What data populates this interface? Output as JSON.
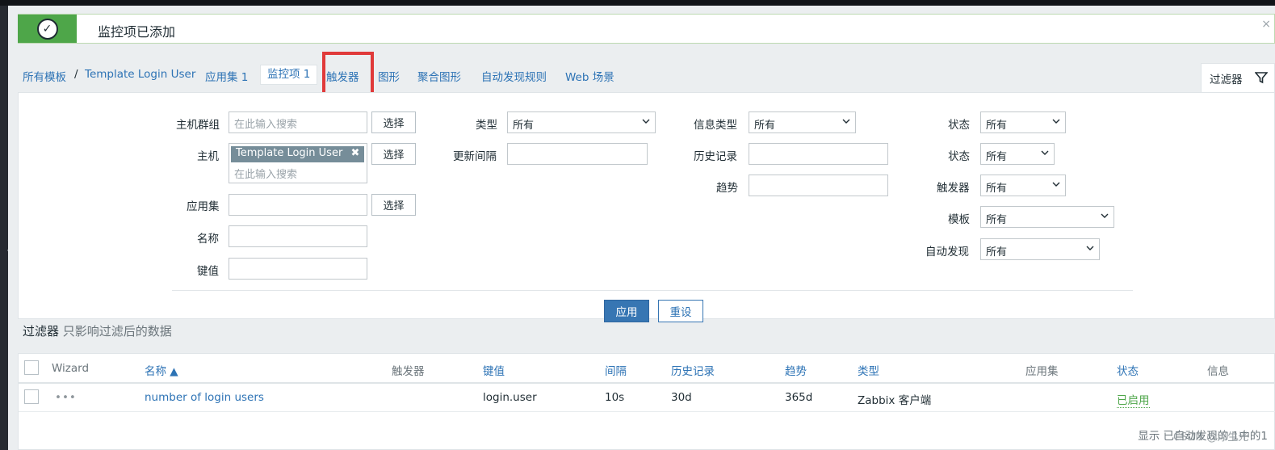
{
  "message": {
    "text": "监控项已添加",
    "close_glyph": "×",
    "status_color": "#4ea649"
  },
  "nav": {
    "all_templates": "所有模板",
    "separator": "/",
    "template_name": "Template Login User",
    "app_sets": "应用集 1",
    "items": "监控项 1",
    "triggers": "触发器",
    "graphs": "图形",
    "aggregate_graphs": "聚合图形",
    "discovery_rules": "自动发现规则",
    "web_scenarios": "Web 场景"
  },
  "filter_tab": {
    "label": "过滤器",
    "icon": "funnel-icon"
  },
  "filter": {
    "host_group_label": "主机群组",
    "host_group_placeholder": "在此输入搜索",
    "host_label": "主机",
    "host_tag": "Template Login User",
    "host_tag_remove": "✖",
    "host_placeholder": "在此输入搜索",
    "app_label": "应用集",
    "name_label": "名称",
    "key_label": "键值",
    "select_button": "选择",
    "type_label": "类型",
    "type_value": "所有",
    "interval_label": "更新间隔",
    "info_type_label": "信息类型",
    "info_type_value": "所有",
    "history_label": "历史记录",
    "trends_label": "趋势",
    "status1_label": "状态",
    "status1_value": "所有",
    "status2_label": "状态",
    "status2_value": "所有",
    "triggers_label": "触发器",
    "triggers_value": "所有",
    "template_label": "模板",
    "template_value": "所有",
    "discovery_label": "自动发现",
    "discovery_value": "所有",
    "apply_button": "应用",
    "reset_button": "重设",
    "note_title": "过滤器",
    "note_sub": "只影响过滤后的数据"
  },
  "table": {
    "headers": {
      "wizard": "Wizard",
      "name": "名称 ▲",
      "triggers": "触发器",
      "key": "键值",
      "interval": "间隔",
      "history": "历史记录",
      "trends": "趋势",
      "type": "类型",
      "applications": "应用集",
      "status": "状态",
      "info": "信息"
    },
    "rows": [
      {
        "wizard": "•••",
        "name": "number of login users",
        "key": "login.user",
        "interval": "10s",
        "history": "30d",
        "trends": "365d",
        "type": "Zabbix 客户端",
        "status": "已启用"
      }
    ],
    "footer": "显示 已自动发现的 1中的1"
  },
  "watermark": "CSDN @浮生光",
  "colors": {
    "link": "#2d73b5",
    "enabled": "#4ea649",
    "highlight": "#e03a3a",
    "primary": "#3776b3"
  }
}
